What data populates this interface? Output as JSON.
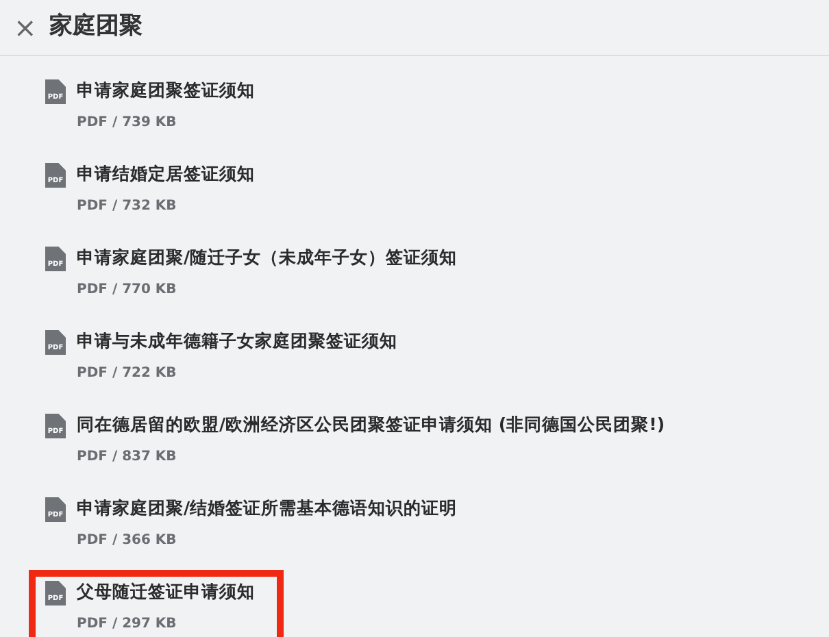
{
  "header": {
    "close": "×",
    "title": "家庭团聚"
  },
  "documents": [
    {
      "icon_text": "PDF",
      "title": "申请家庭团聚签证须知",
      "meta": "PDF / 739 KB",
      "highlighted": false
    },
    {
      "icon_text": "PDF",
      "title": "申请结婚定居签证须知",
      "meta": "PDF / 732 KB",
      "highlighted": false
    },
    {
      "icon_text": "PDF",
      "title": "申请家庭团聚/随迁子女（未成年子女）签证须知",
      "meta": "PDF / 770 KB",
      "highlighted": false
    },
    {
      "icon_text": "PDF",
      "title": "申请与未成年德籍子女家庭团聚签证须知",
      "meta": "PDF / 722 KB",
      "highlighted": false
    },
    {
      "icon_text": "PDF",
      "title": "同在德居留的欧盟/欧洲经济区公民团聚签证申请须知 (非同德国公民团聚!)",
      "meta": "PDF / 837 KB",
      "highlighted": false
    },
    {
      "icon_text": "PDF",
      "title": "申请家庭团聚/结婚签证所需基本德语知识的证明",
      "meta": "PDF / 366 KB",
      "highlighted": false
    },
    {
      "icon_text": "PDF",
      "title": "父母随迁签证申请须知",
      "meta": "PDF / 297 KB",
      "highlighted": true
    }
  ]
}
